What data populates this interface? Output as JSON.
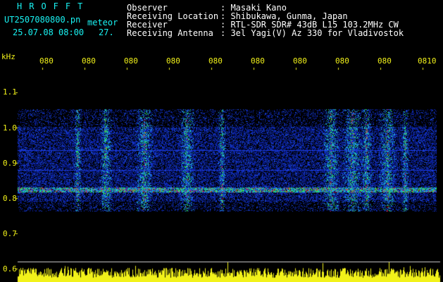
{
  "header": {
    "brand": "HROFFT",
    "filename": "UT2507080800.pn",
    "mode": "meteor",
    "datetime": "25.07.08 08:00",
    "count": "27.",
    "fields": [
      {
        "label": "Observer",
        "value": ": Masaki Kano"
      },
      {
        "label": "Receiving Location",
        "value": ": Shibukawa, Gunma, Japan"
      },
      {
        "label": "Receiver",
        "value": ": RTL-SDR SDR# 43dB L15 103.2MHz CW"
      },
      {
        "label": "Receiving Antenna",
        "value": ": 3el Yagi(V) Az 330 for Vladivostok"
      }
    ]
  },
  "axis": {
    "unit": "kHz",
    "y_ticks": [
      "1.1",
      "1.0",
      "0.9",
      "0.8",
      "0.7",
      "0.6"
    ],
    "x_ticks": [
      "080",
      "080",
      "080",
      "080",
      "080",
      "080",
      "080",
      "080",
      "080",
      "0810"
    ]
  },
  "colors": {
    "background": "#000000",
    "header_text": "#ffffff",
    "accent_cyan": "#19f2f2",
    "axis_yellow": "#f2f21a",
    "spectrum_blue": "#0a2ad0"
  }
}
